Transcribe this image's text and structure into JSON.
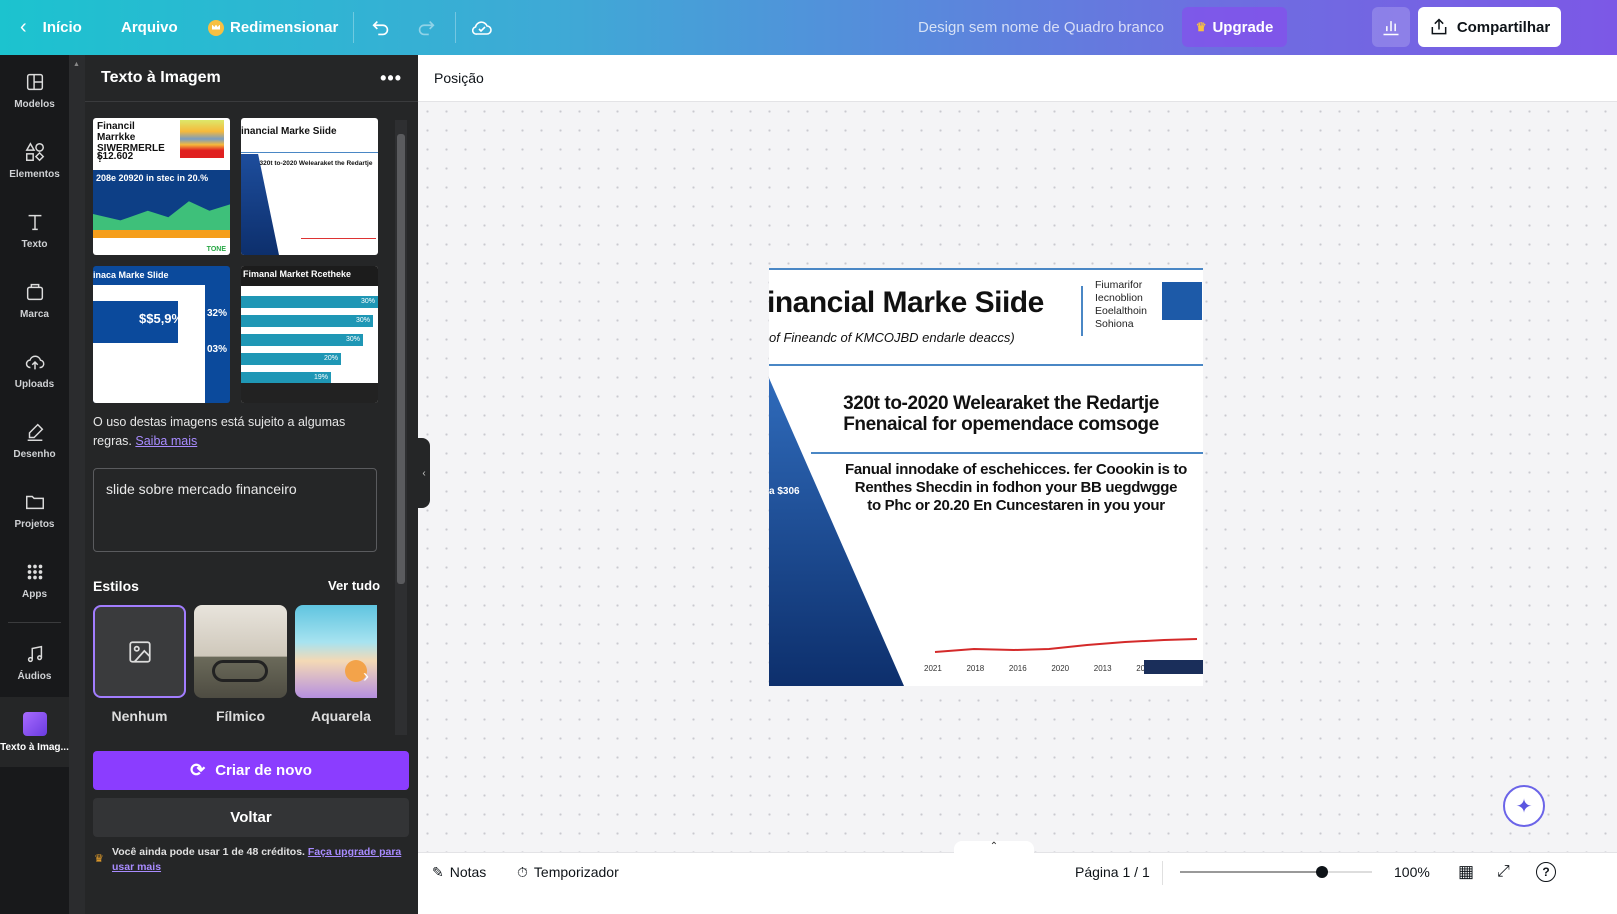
{
  "topbar": {
    "home": "Início",
    "file": "Arquivo",
    "resize": "Redimensionar",
    "title": "Design sem nome de Quadro branco",
    "upgrade": "Upgrade",
    "share": "Compartilhar"
  },
  "rail": [
    {
      "label": "Modelos",
      "icon": "layout-icon"
    },
    {
      "label": "Elementos",
      "icon": "shapes-icon"
    },
    {
      "label": "Texto",
      "icon": "text-icon"
    },
    {
      "label": "Marca",
      "icon": "brand-icon"
    },
    {
      "label": "Uploads",
      "icon": "cloud-upload-icon"
    },
    {
      "label": "Desenho",
      "icon": "pen-icon"
    },
    {
      "label": "Projetos",
      "icon": "folder-icon"
    },
    {
      "label": "Apps",
      "icon": "grid-icon"
    },
    {
      "label": "Áudios",
      "icon": "music-icon"
    },
    {
      "label": "Texto à Imag...",
      "icon": "text-to-image-icon"
    }
  ],
  "panel": {
    "title": "Texto à Imagem",
    "thumbnails": [
      {
        "title": "Financil Marrkke SIWERMERLE ?",
        "value": "$12.602",
        "headline": "208e 20920 in stec in 20.%",
        "brand": "TONE"
      },
      {
        "title": "inancial Marke Siide",
        "headline": "320t to-2020 Welearaket the Redartje"
      },
      {
        "title": "inaca Marke Slide",
        "value": "$$5,9%",
        "stat1": "32%",
        "stat2": "03%"
      },
      {
        "title": "Fimanal Market Rcetheke",
        "bars": [
          "30%",
          "30%",
          "30%",
          "20%",
          "19%"
        ]
      }
    ],
    "usage_note": "O uso destas imagens está sujeito a algumas regras.",
    "learn_more": "Saiba mais",
    "prompt": "slide sobre mercado financeiro",
    "styles_label": "Estilos",
    "see_all": "Ver tudo",
    "styles": [
      {
        "label": "Nenhum",
        "selected": true
      },
      {
        "label": "Fílmico",
        "selected": false
      },
      {
        "label": "Aquarela",
        "selected": false
      }
    ],
    "create_again": "Criar de novo",
    "back": "Voltar",
    "credits": "Você ainda pode usar 1 de 48 créditos.",
    "credits_link": "Faça upgrade para usar mais"
  },
  "toolbar": {
    "position": "Posição"
  },
  "slide": {
    "title": "inancial Marke Siide",
    "subtitle": "of Fineandc of KMCOJBD endarle deaccs)",
    "side": [
      "Fiumarifor",
      "Iecnoblion",
      "Eoelalthoin",
      "Sohiona"
    ],
    "heading1": "320t to-2020 Welearaket the Redartje",
    "heading2": "Fnenaical for opemendace comsoge",
    "body": [
      "Fanual innodake of eschehicces. fer Coookin is to",
      "Renthes Shecdin in fodhon your BB uegdwgge",
      "to Phc or 20.20 En Cuncestaren in you your"
    ],
    "left_value": "a $306",
    "axis": [
      "2021",
      "2018",
      "2016",
      "2020",
      "2013",
      "2015"
    ]
  },
  "bottom": {
    "notes": "Notas",
    "timer": "Temporizador",
    "page": "Página 1 / 1",
    "zoom": "100%",
    "zoom_level": 0.74
  },
  "colors": {
    "accent": "#8b3dff",
    "panel": "#252627",
    "rail": "#18191b"
  }
}
